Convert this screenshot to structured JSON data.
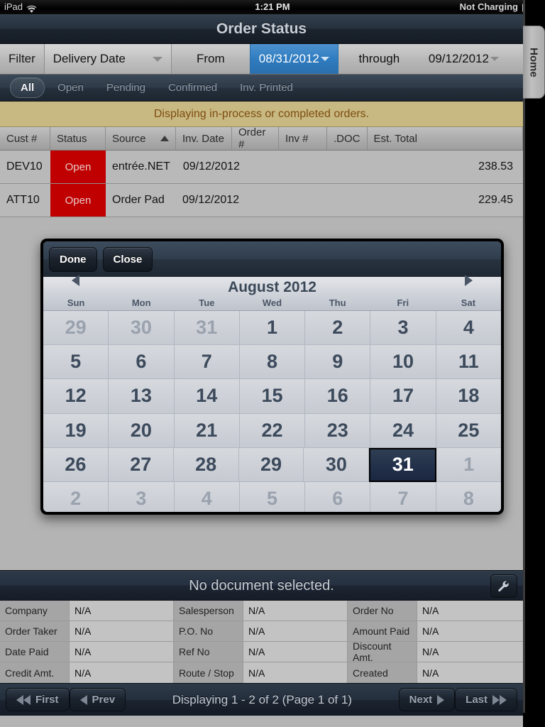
{
  "statusbar": {
    "device": "iPad",
    "wifi_icon": "wifi-icon",
    "time": "1:21 PM",
    "battery_text": "Not Charging",
    "battery_icon": "battery-icon"
  },
  "titlebar": {
    "title": "Order Status"
  },
  "home_tab": {
    "label": "Home"
  },
  "filterbar": {
    "filter_label": "Filter",
    "filter_value": "Delivery Date",
    "from_label": "From",
    "from_value": "08/31/2012",
    "through_label": "through",
    "through_value": "09/12/2012"
  },
  "tabs": [
    {
      "label": "All",
      "active": true
    },
    {
      "label": "Open",
      "active": false
    },
    {
      "label": "Pending",
      "active": false
    },
    {
      "label": "Confirmed",
      "active": false
    },
    {
      "label": "Inv. Printed",
      "active": false
    }
  ],
  "notice": {
    "text": "Displaying in-process or completed orders."
  },
  "grid": {
    "columns": [
      {
        "label": "Cust #"
      },
      {
        "label": "Status"
      },
      {
        "label": "Source",
        "sort": "ascending"
      },
      {
        "label": "Inv. Date"
      },
      {
        "label": "Order #"
      },
      {
        "label": "Inv #"
      },
      {
        "label": ".DOC"
      },
      {
        "label": "Est. Total"
      }
    ],
    "rows": [
      {
        "cust": "DEV10",
        "status": "Open",
        "source": "entrée.NET",
        "inv_date": "09/12/2012",
        "order_no": "",
        "inv_no": "",
        "doc": "",
        "est_total": "238.53"
      },
      {
        "cust": "ATT10",
        "status": "Open",
        "source": "Order Pad",
        "inv_date": "09/12/2012",
        "order_no": "",
        "inv_no": "",
        "doc": "",
        "est_total": "229.45"
      }
    ]
  },
  "calendar": {
    "done_label": "Done",
    "close_label": "Close",
    "title": "August 2012",
    "prev_icon": "chevron-left-icon",
    "next_icon": "chevron-right-icon",
    "weekdays": [
      "Sun",
      "Mon",
      "Tue",
      "Wed",
      "Thu",
      "Fri",
      "Sat"
    ],
    "selected_day": "31",
    "weeks": [
      [
        {
          "d": "29",
          "muted": true
        },
        {
          "d": "30",
          "muted": true
        },
        {
          "d": "31",
          "muted": true
        },
        {
          "d": "1"
        },
        {
          "d": "2"
        },
        {
          "d": "3"
        },
        {
          "d": "4"
        }
      ],
      [
        {
          "d": "5"
        },
        {
          "d": "6"
        },
        {
          "d": "7"
        },
        {
          "d": "8"
        },
        {
          "d": "9"
        },
        {
          "d": "10"
        },
        {
          "d": "11"
        }
      ],
      [
        {
          "d": "12"
        },
        {
          "d": "13"
        },
        {
          "d": "14"
        },
        {
          "d": "15"
        },
        {
          "d": "16"
        },
        {
          "d": "17"
        },
        {
          "d": "18"
        }
      ],
      [
        {
          "d": "19"
        },
        {
          "d": "20"
        },
        {
          "d": "21"
        },
        {
          "d": "22"
        },
        {
          "d": "23"
        },
        {
          "d": "24"
        },
        {
          "d": "25"
        }
      ],
      [
        {
          "d": "26"
        },
        {
          "d": "27"
        },
        {
          "d": "28"
        },
        {
          "d": "29"
        },
        {
          "d": "30"
        },
        {
          "d": "31",
          "selected": true
        },
        {
          "d": "1",
          "muted": true
        }
      ],
      [
        {
          "d": "2",
          "muted": true
        },
        {
          "d": "3",
          "muted": true
        },
        {
          "d": "4",
          "muted": true
        },
        {
          "d": "5",
          "muted": true
        },
        {
          "d": "6",
          "muted": true
        },
        {
          "d": "7",
          "muted": true
        },
        {
          "d": "8",
          "muted": true
        }
      ]
    ]
  },
  "document_panel": {
    "header": "No document selected.",
    "settings_icon": "wrench-icon",
    "rows": [
      [
        {
          "key": "Company",
          "value": "N/A"
        },
        {
          "key": "Salesperson",
          "value": "N/A"
        },
        {
          "key": "Order No",
          "value": "N/A"
        }
      ],
      [
        {
          "key": "Order Taker",
          "value": "N/A"
        },
        {
          "key": "P.O. No",
          "value": "N/A"
        },
        {
          "key": "Amount Paid",
          "value": "N/A"
        }
      ],
      [
        {
          "key": "Date Paid",
          "value": "N/A"
        },
        {
          "key": "Ref No",
          "value": "N/A"
        },
        {
          "key": "Discount Amt.",
          "value": "N/A"
        }
      ],
      [
        {
          "key": "Credit Amt.",
          "value": "N/A"
        },
        {
          "key": "Route / Stop",
          "value": "N/A"
        },
        {
          "key": "Created",
          "value": "N/A"
        }
      ]
    ]
  },
  "bottombar": {
    "first_label": "First",
    "prev_label": "Prev",
    "paging_text": "Displaying 1 - 2 of 2 (Page 1 of 1)",
    "next_label": "Next",
    "last_label": "Last"
  },
  "colors": {
    "accent_blue": "#2f7cc0",
    "status_open_red": "#c00000",
    "notice_bg": "#c8b882",
    "notice_text": "#7e4e10",
    "chrome_dark": "#25303c"
  }
}
